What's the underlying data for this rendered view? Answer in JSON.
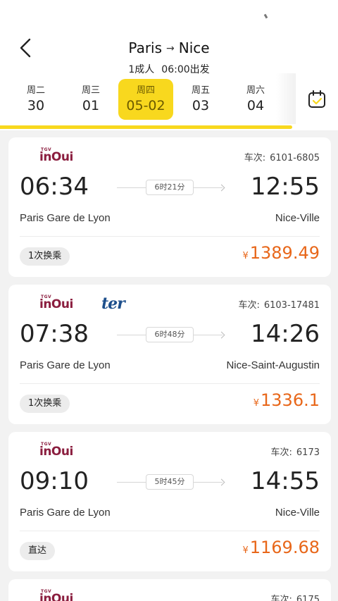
{
  "header": {
    "origin": "Paris",
    "destination": "Nice",
    "passengers": "1成人",
    "time": "06:00出发"
  },
  "dates": [
    {
      "weekday": "周二",
      "date": "30",
      "active": false
    },
    {
      "weekday": "周三",
      "date": "01",
      "active": false
    },
    {
      "weekday": "周四",
      "date": "05-02",
      "active": true
    },
    {
      "weekday": "周五",
      "date": "03",
      "active": false
    },
    {
      "weekday": "周六",
      "date": "04",
      "active": false
    }
  ],
  "train_label": "车次:",
  "trains": [
    {
      "operators": [
        "inOui"
      ],
      "number": "6101-6805",
      "dep_time": "06:34",
      "arr_time": "12:55",
      "duration": "6时21分",
      "dep_station": "Paris Gare de Lyon",
      "arr_station": "Nice-Ville",
      "transfer": "1次换乘",
      "currency": "¥",
      "price": "1389.49"
    },
    {
      "operators": [
        "inOui",
        "ter"
      ],
      "number": "6103-17481",
      "dep_time": "07:38",
      "arr_time": "14:26",
      "duration": "6时48分",
      "dep_station": "Paris Gare de Lyon",
      "arr_station": "Nice-Saint-Augustin",
      "transfer": "1次换乘",
      "currency": "¥",
      "price": "1336.1"
    },
    {
      "operators": [
        "inOui"
      ],
      "number": "6173",
      "dep_time": "09:10",
      "arr_time": "14:55",
      "duration": "5时45分",
      "dep_station": "Paris Gare de Lyon",
      "arr_station": "Nice-Ville",
      "transfer": "直达",
      "currency": "¥",
      "price": "1169.68"
    },
    {
      "operators": [
        "inOui"
      ],
      "number": "6175"
    }
  ],
  "logos": {
    "tgv_small": "TGV",
    "inoui_text": "inOui",
    "ter_text": "ter"
  },
  "colors": {
    "accent_yellow": "#f8d81e",
    "price_orange": "#e8671a",
    "inoui_brand": "#8b1e3f",
    "ter_blue": "#1d4f8c"
  }
}
